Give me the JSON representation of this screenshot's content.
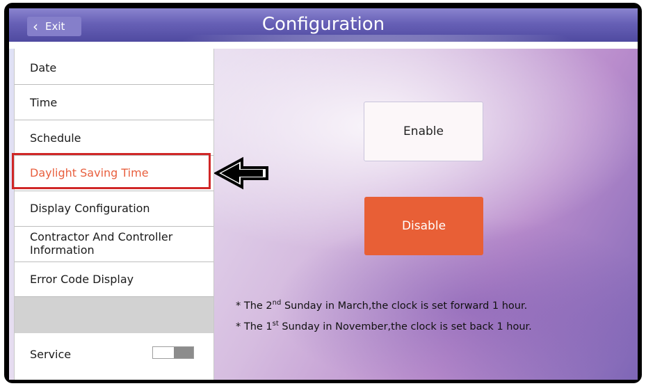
{
  "header": {
    "exit_label": "Exit",
    "title": "Configuration"
  },
  "sidebar": {
    "items": [
      {
        "label": "Date"
      },
      {
        "label": "Time"
      },
      {
        "label": "Schedule"
      },
      {
        "label": "Daylight Saving Time",
        "active": true
      },
      {
        "label": "Display Configuration"
      },
      {
        "label_line1": "Contractor And Controller",
        "label_line2": "Information"
      },
      {
        "label": "Error Code Display"
      }
    ],
    "service_label": "Service",
    "service_toggle": "off"
  },
  "main": {
    "enable_label": "Enable",
    "disable_label": "Disable",
    "note1": {
      "prefix": "* The 2",
      "sup": "nd",
      "suffix": " Sunday in March,the clock is set forward 1 hour."
    },
    "note2": {
      "prefix": "* The 1",
      "sup": "st",
      "suffix": " Sunday in November,the clock is set back 1 hour."
    }
  },
  "colors": {
    "accent": "#e85f36",
    "active_text": "#e85f3e",
    "highlight_border": "#d02727",
    "titlebar": "#6760b6"
  }
}
